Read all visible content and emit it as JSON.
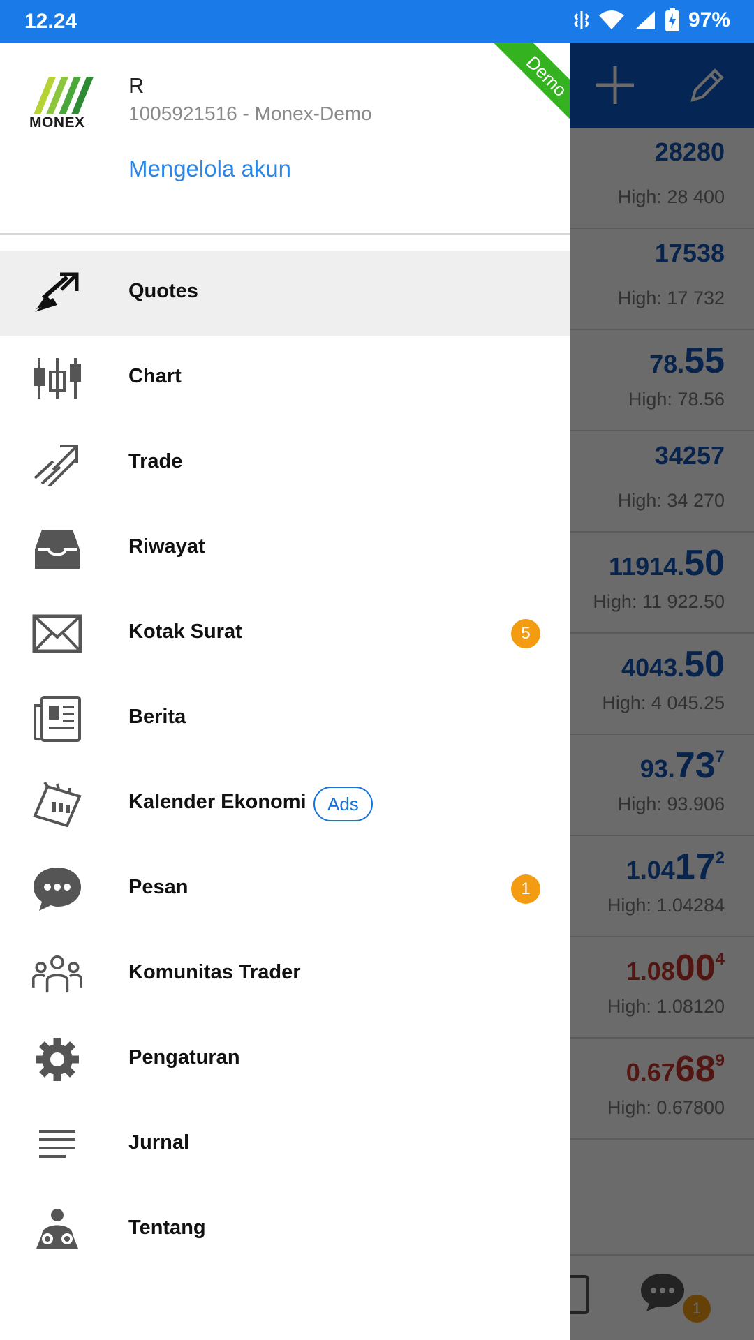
{
  "status_bar": {
    "time": "12.24",
    "battery": "97%"
  },
  "background": {
    "quotes": [
      {
        "price_small": "",
        "price_big": "28280",
        "price_sup": "",
        "high": "High: 28 400",
        "direction": "up"
      },
      {
        "price_small": "",
        "price_big": "17538",
        "price_sup": "",
        "high": "High: 17 732",
        "direction": "up"
      },
      {
        "price_small": "78.",
        "price_big": "55",
        "price_sup": "",
        "high": "High: 78.56",
        "direction": "up"
      },
      {
        "price_small": "",
        "price_big": "34257",
        "price_sup": "",
        "high": "High: 34 270",
        "direction": "up"
      },
      {
        "price_small": "11914.",
        "price_big": "50",
        "price_sup": "",
        "high": "High: 11 922.50",
        "direction": "up"
      },
      {
        "price_small": "4043.",
        "price_big": "50",
        "price_sup": "",
        "high": "High: 4 045.25",
        "direction": "up"
      },
      {
        "price_small": "93.",
        "price_big": "73",
        "price_sup": "7",
        "high": "High: 93.906",
        "direction": "up"
      },
      {
        "price_small": "1.04",
        "price_big": "17",
        "price_sup": "2",
        "high": "High: 1.04284",
        "direction": "up"
      },
      {
        "price_small": "1.08",
        "price_big": "00",
        "price_sup": "4",
        "high": "High: 1.08120",
        "direction": "down"
      },
      {
        "price_small": "0.67",
        "price_big": "68",
        "price_sup": "9",
        "high": "High: 0.67800",
        "direction": "down"
      }
    ],
    "bottom_chat_badge": "1"
  },
  "drawer": {
    "logo_text": "MONEX",
    "account_name": "R",
    "account_number": "1005921516 - Monex-Demo",
    "manage_link": "Mengelola akun",
    "ribbon": "Demo",
    "menu": [
      {
        "label": "Quotes",
        "icon": "quotes-icon",
        "active": true
      },
      {
        "label": "Chart",
        "icon": "chart-icon"
      },
      {
        "label": "Trade",
        "icon": "trade-icon"
      },
      {
        "label": "Riwayat",
        "icon": "history-icon"
      },
      {
        "label": "Kotak Surat",
        "icon": "mail-icon",
        "badge": "5"
      },
      {
        "label": "Berita",
        "icon": "news-icon"
      },
      {
        "label": "Kalender Ekonomi",
        "icon": "calendar-icon",
        "tag": "Ads"
      },
      {
        "label": "Pesan",
        "icon": "chat-icon",
        "badge": "1"
      },
      {
        "label": "Komunitas Trader",
        "icon": "community-icon"
      },
      {
        "label": "Pengaturan",
        "icon": "settings-icon"
      },
      {
        "label": "Jurnal",
        "icon": "journal-icon"
      },
      {
        "label": "Tentang",
        "icon": "about-icon"
      }
    ]
  },
  "colors": {
    "status_bar": "#1a7ae8",
    "toolbar": "#0d5cc8",
    "price_up": "#1456b8",
    "price_down": "#c0332b",
    "badge": "#f39c12",
    "ribbon": "#34b21f",
    "link": "#2b87e3"
  }
}
